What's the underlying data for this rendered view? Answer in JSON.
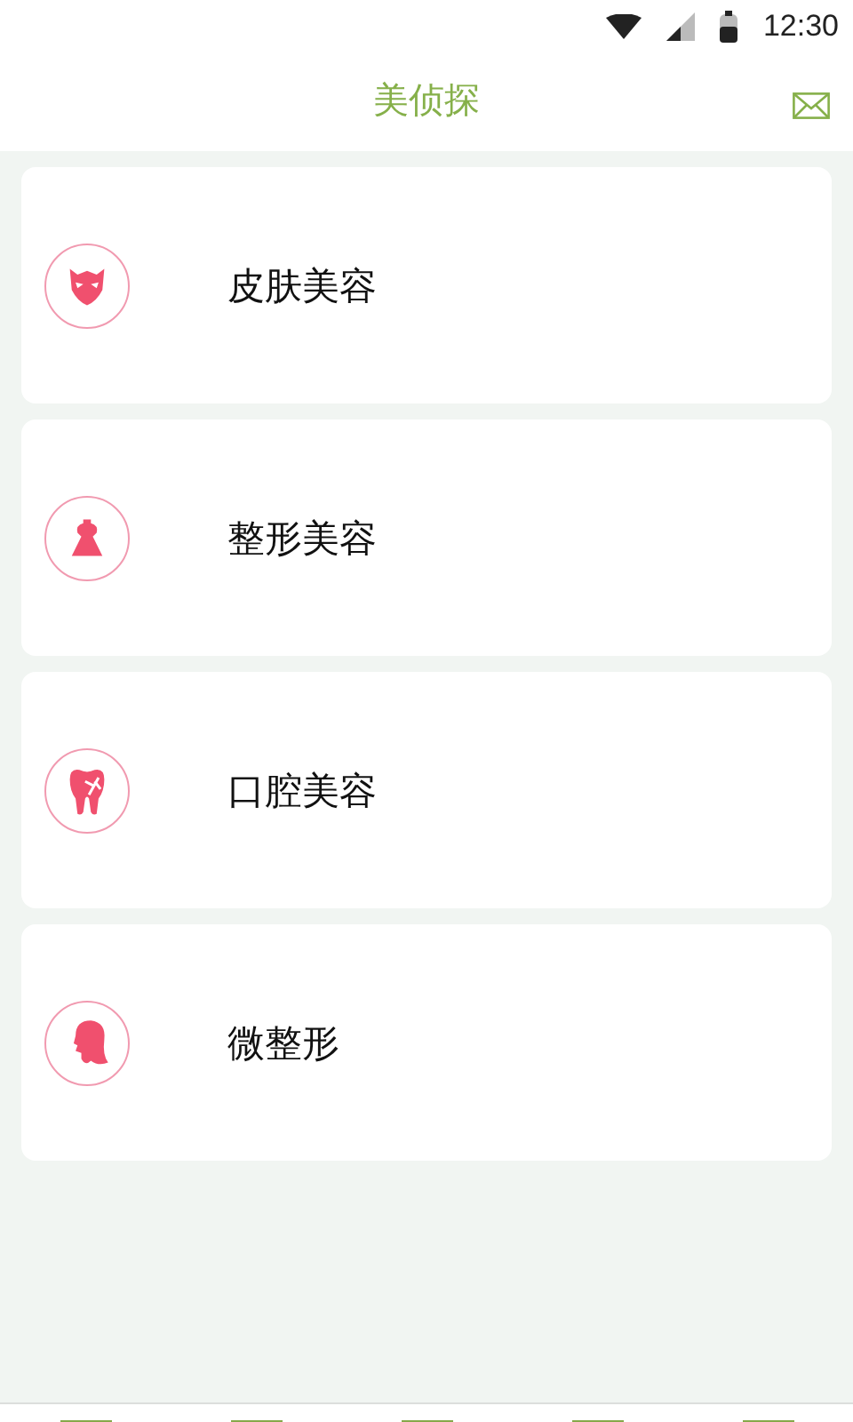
{
  "status_bar": {
    "time": "12:30"
  },
  "header": {
    "title": "美侦探"
  },
  "categories": [
    {
      "kind": "mask",
      "label": "皮肤美容"
    },
    {
      "kind": "dress",
      "label": "整形美容"
    },
    {
      "kind": "tooth",
      "label": "口腔美容"
    },
    {
      "kind": "head",
      "label": "微整形"
    }
  ]
}
